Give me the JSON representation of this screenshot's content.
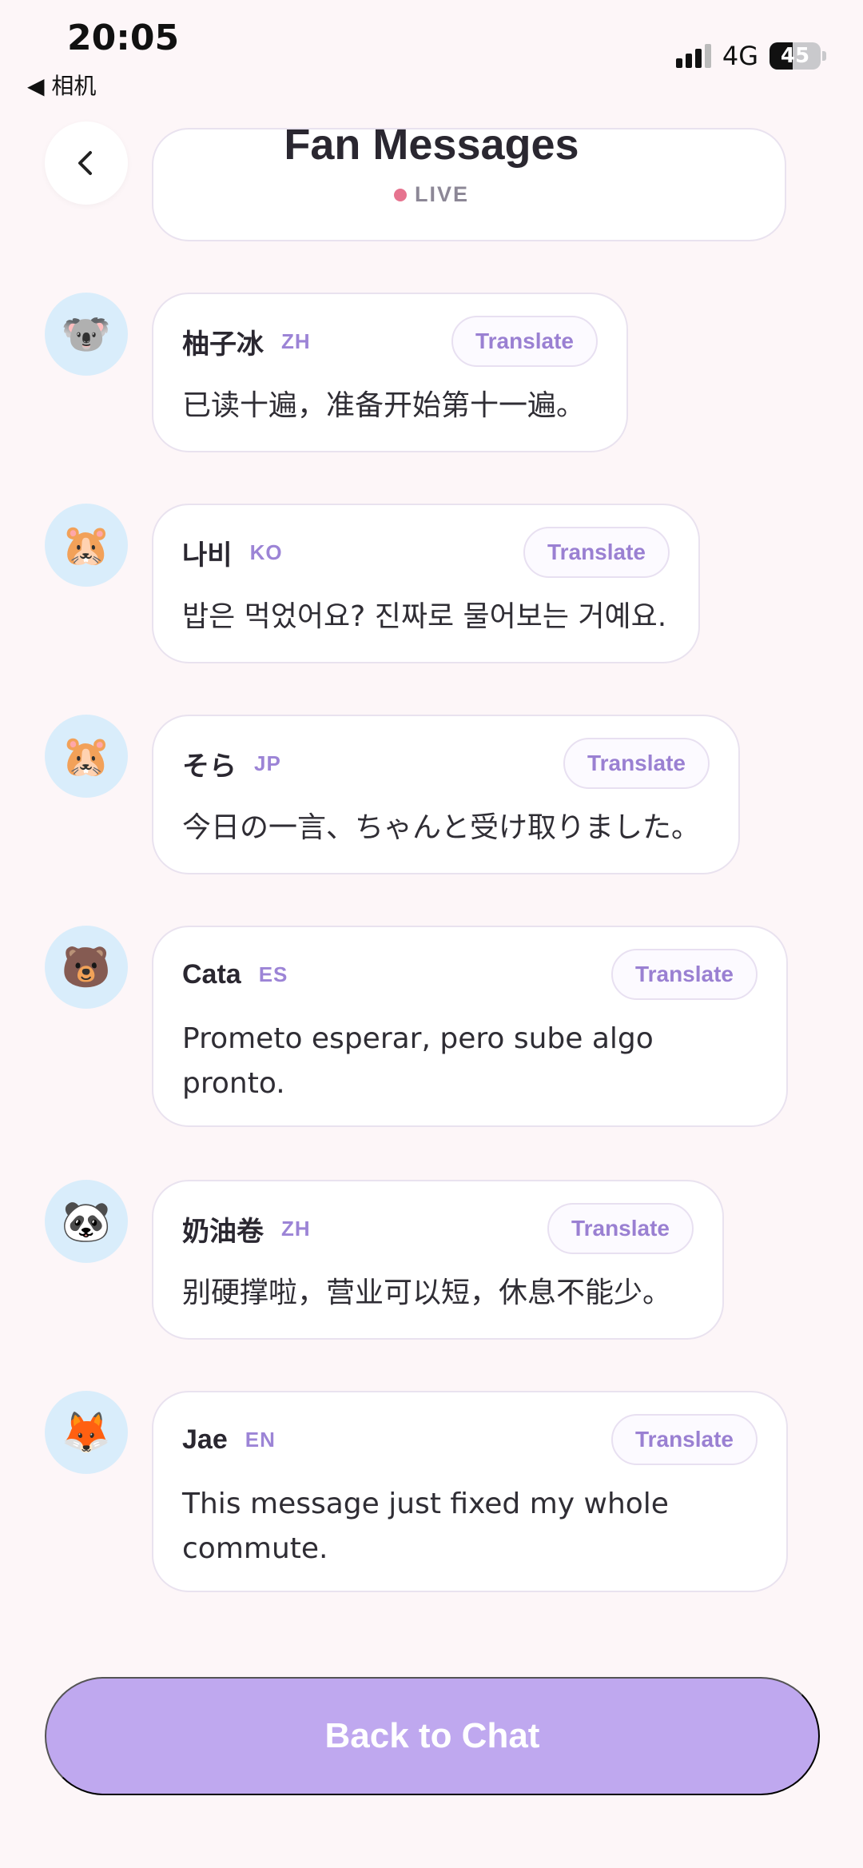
{
  "status_bar": {
    "time": "20:05",
    "back_app": "◀ 相机",
    "network": "4G",
    "battery_level": "45",
    "battery_fraction": 0.45
  },
  "header": {
    "title": "Fan Messages",
    "live_label": "LIVE"
  },
  "colors": {
    "background": "#fdf6f8",
    "accent": "#9a80d2",
    "primary_button": "#bfa8ef",
    "avatar_bg": "#d9edfb",
    "live_dot": "#e6738f"
  },
  "messages": [
    {
      "avatar": "🐨",
      "avatar_icon": "koala-icon",
      "sender": "柚子冰",
      "lang": "ZH",
      "translate_label": "Translate",
      "text": "已读十遍，准备开始第十一遍。"
    },
    {
      "avatar": "🐹",
      "avatar_icon": "hamster-icon",
      "sender": "나비",
      "lang": "KO",
      "translate_label": "Translate",
      "text": "밥은 먹었어요? 진짜로 물어보는 거예요."
    },
    {
      "avatar": "🐹",
      "avatar_icon": "hamster-icon",
      "sender": "そら",
      "lang": "JP",
      "translate_label": "Translate",
      "text": "今日の一言、ちゃんと受け取りました。"
    },
    {
      "avatar": "🐻",
      "avatar_icon": "bear-icon",
      "sender": "Cata",
      "lang": "ES",
      "translate_label": "Translate",
      "text": "Prometo esperar, pero sube algo pronto."
    },
    {
      "avatar": "🐼",
      "avatar_icon": "panda-icon",
      "sender": "奶油卷",
      "lang": "ZH",
      "translate_label": "Translate",
      "text": "别硬撑啦，营业可以短，休息不能少。"
    },
    {
      "avatar": "🦊",
      "avatar_icon": "fox-icon",
      "sender": "Jae",
      "lang": "EN",
      "translate_label": "Translate",
      "text": "This message just fixed my whole commute."
    }
  ],
  "footer": {
    "back_to_chat_label": "Back to Chat"
  }
}
